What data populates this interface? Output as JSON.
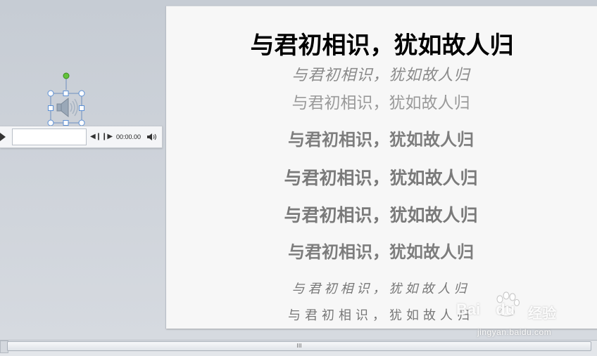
{
  "slide": {
    "title": "与君初相识，犹如故人归",
    "lines": [
      "与君初相识，犹如故人归",
      "与君初相识，犹如故人归",
      "与君初相识，犹如故人归",
      "与君初相识，犹如故人归",
      "与君初相识，犹如故人归",
      "与君初相识，犹如故人归",
      "与君初相识，犹如故人归",
      "与君初相识，犹如故人归"
    ]
  },
  "audio_player": {
    "time": "00:00.00",
    "icons": {
      "play": "play-icon",
      "seek_back": "seek-back-icon",
      "seek_forward": "seek-forward-icon",
      "volume": "volume-icon",
      "speaker_object": "speaker-icon"
    }
  },
  "scrollbar": {
    "grip": "III"
  },
  "watermark": {
    "logo": "Bai",
    "logo_suffix": "du",
    "brand_cn": "经验",
    "url": "jingyan.baidu.com"
  },
  "colors": {
    "workspace": "#c9ced6",
    "slide_bg": "#f7f7f7",
    "handle_green": "#63c33a",
    "handle_blue": "#5b8fd4"
  }
}
